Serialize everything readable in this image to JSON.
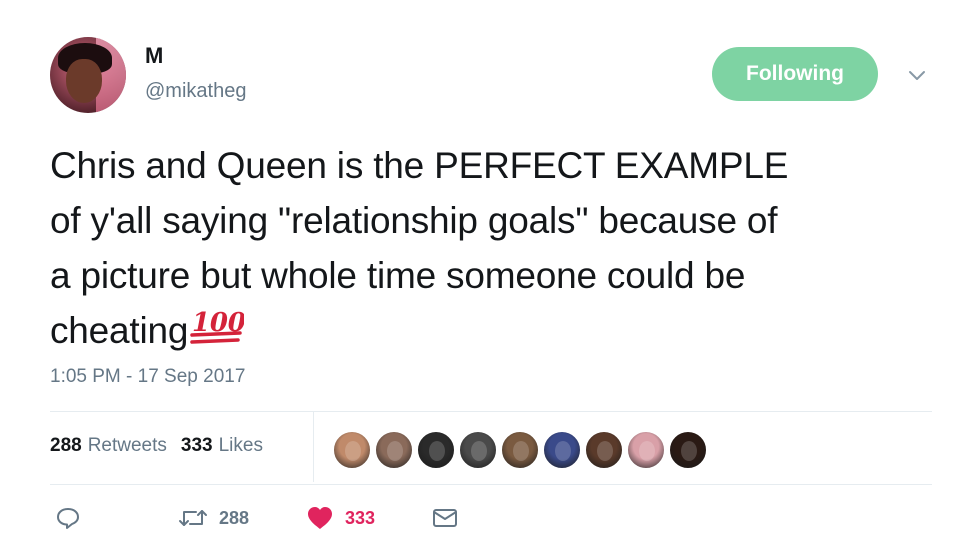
{
  "user": {
    "display_name": "M",
    "handle": "@mikatheg"
  },
  "follow_button": {
    "label": "Following"
  },
  "tweet": {
    "line1": "Chris and Queen is the PERFECT EXAMPLE",
    "line2": "of y'all saying \"relationship goals\" because of",
    "line3": "a picture but whole time someone could be",
    "line4": "cheating",
    "emoji": "hundred-points-icon",
    "timestamp": "1:05 PM - 17 Sep 2017"
  },
  "stats": {
    "retweets_count": "288",
    "retweets_label": "Retweets",
    "likes_count": "333",
    "likes_label": "Likes"
  },
  "likers": [
    {
      "color": "#c08a6a"
    },
    {
      "color": "#8a6a5a"
    },
    {
      "color": "#2a2a2a"
    },
    {
      "color": "#4a4a4a"
    },
    {
      "color": "#7a5a40"
    },
    {
      "color": "#3a4a8a"
    },
    {
      "color": "#5a3a2a"
    },
    {
      "color": "#d9a0a8"
    },
    {
      "color": "#2a1a14"
    }
  ],
  "actions": {
    "reply_icon": "reply-icon",
    "retweet_icon": "retweet-icon",
    "retweet_count": "288",
    "like_icon": "heart-icon",
    "like_count": "333",
    "dm_icon": "envelope-icon"
  },
  "colors": {
    "following_button": "#7ed3a3",
    "like_active": "#e0245e",
    "secondary_text": "#657786"
  }
}
